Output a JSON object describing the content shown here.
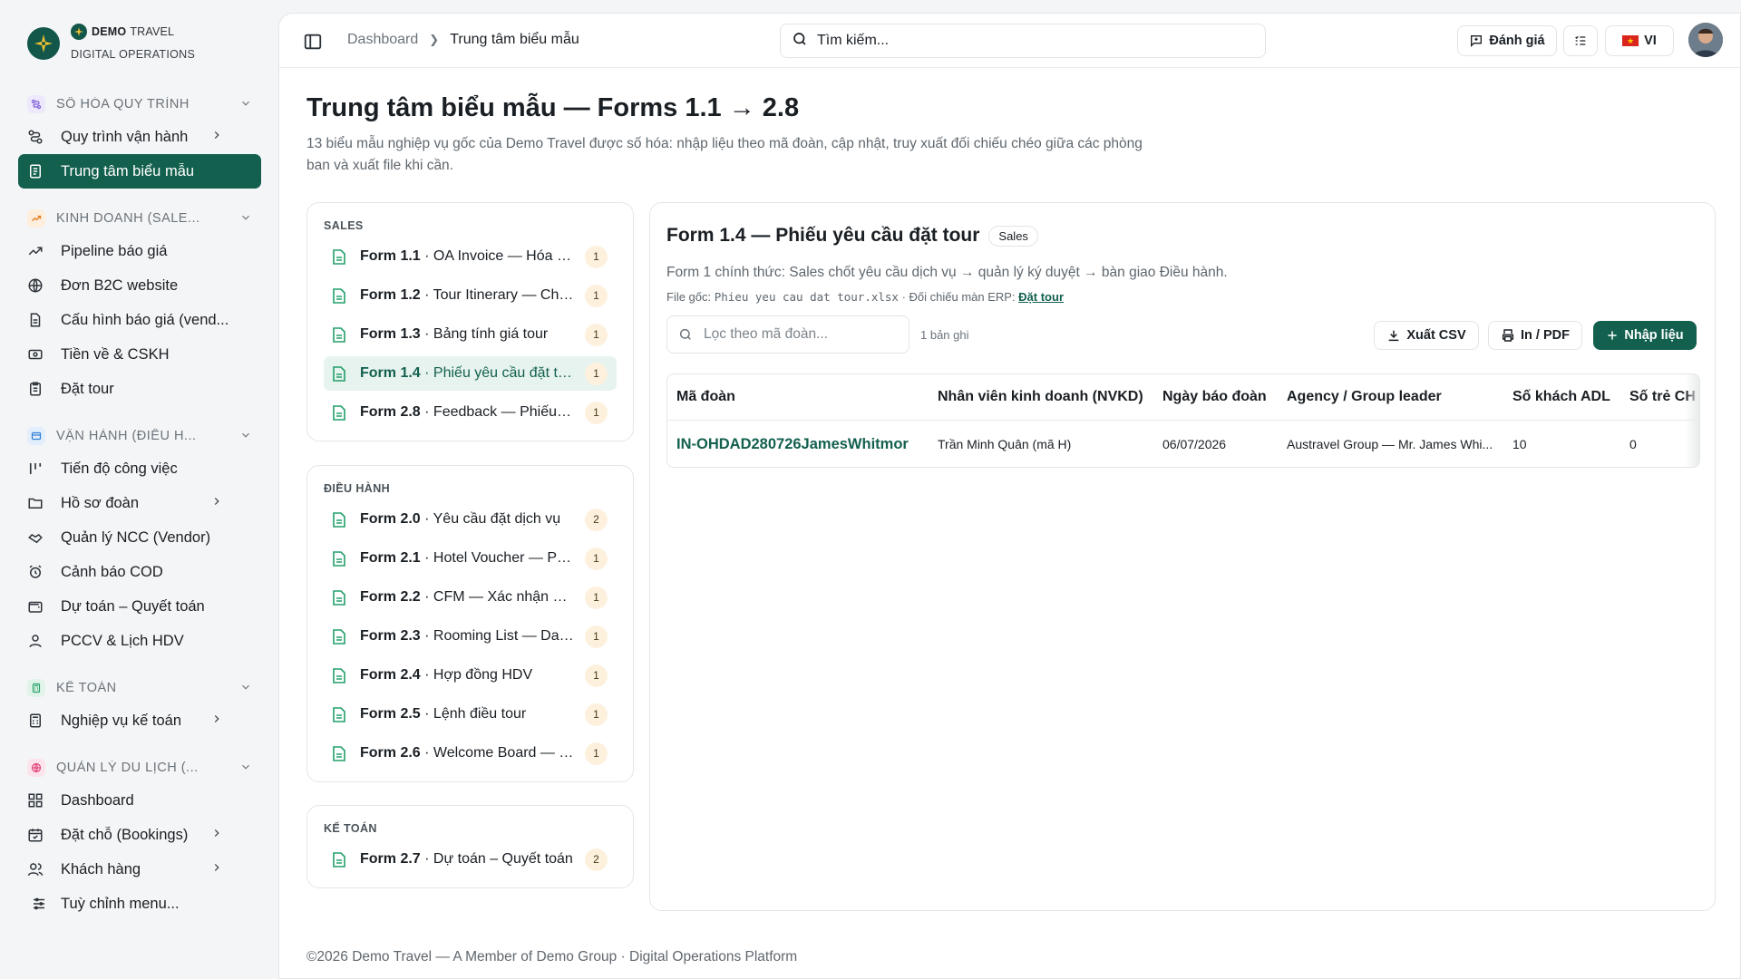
{
  "brand": {
    "name_bold": "DEMO",
    "name_light": "TRAVEL",
    "subtitle": "DIGITAL OPERATIONS"
  },
  "sidebar": {
    "sections": [
      {
        "label": "SỐ HÓA QUY TRÌNH",
        "icon": "workflow-icon",
        "color": "#7b5cd6",
        "items": [
          {
            "label": "Quy trình vận hành",
            "icon": "workflow-icon",
            "has_children": true
          },
          {
            "label": "Trung tâm biểu mẫu",
            "icon": "form-icon",
            "active": true
          }
        ]
      },
      {
        "label": "KINH DOANH (SALE...",
        "icon": "trend-icon",
        "color": "#e07b1f",
        "items": [
          {
            "label": "Pipeline báo giá",
            "icon": "trend-icon"
          },
          {
            "label": "Đơn B2C website",
            "icon": "globe-icon"
          },
          {
            "label": "Cấu hình báo giá (vend...",
            "icon": "document-icon"
          },
          {
            "label": "Tiền về & CSKH",
            "icon": "money-icon"
          },
          {
            "label": "Đặt tour",
            "icon": "clipboard-icon"
          }
        ]
      },
      {
        "label": "VẬN HÀNH (ĐIỀU H...",
        "icon": "operations-icon",
        "color": "#2f7fd3",
        "items": [
          {
            "label": "Tiến độ công việc",
            "icon": "progress-icon"
          },
          {
            "label": "Hồ sơ đoàn",
            "icon": "folder-icon",
            "has_children": true
          },
          {
            "label": "Quản lý NCC (Vendor)",
            "icon": "handshake-icon"
          },
          {
            "label": "Cảnh báo COD",
            "icon": "alarm-icon"
          },
          {
            "label": "Dự toán – Quyết toán",
            "icon": "wallet-icon"
          },
          {
            "label": "PCCV & Lịch HDV",
            "icon": "user-icon"
          }
        ]
      },
      {
        "label": "KẾ TOÁN",
        "icon": "calculator-icon",
        "color": "#22a06b",
        "items": [
          {
            "label": "Nghiệp vụ kế toán",
            "icon": "calculator-icon",
            "has_children": true
          }
        ]
      },
      {
        "label": "QUẢN LÝ DU LỊCH (...",
        "icon": "globe-icon",
        "color": "#e0457b",
        "items": [
          {
            "label": "Dashboard",
            "icon": "grid-icon"
          },
          {
            "label": "Đặt chỗ (Bookings)",
            "icon": "calendar-icon",
            "has_children": true
          },
          {
            "label": "Khách hàng",
            "icon": "users-icon",
            "has_children": true
          }
        ]
      }
    ],
    "customize_label": "Tuỳ chỉnh menu..."
  },
  "topbar": {
    "breadcrumb": [
      "Dashboard",
      "Trung tâm biểu mẫu"
    ],
    "search_placeholder": "Tìm kiếm...",
    "feedback_label": "Đánh giá",
    "language_label": "VI"
  },
  "page": {
    "title": "Trung tâm biểu mẫu — Forms 1.1 → 2.8",
    "description": "13 biểu mẫu nghiệp vụ gốc của Demo Travel được số hóa: nhập liệu theo mã đoàn, cập nhật, truy xuất đối chiếu chéo giữa các phòng ban và xuất file khi cần."
  },
  "categories": [
    {
      "title": "SALES",
      "forms": [
        {
          "code": "Form 1.1",
          "name": "· OA Invoice — Hóa đơn",
          "count": "1"
        },
        {
          "code": "Form 1.2",
          "name": "· Tour Itinerary — Chương trình",
          "count": "1"
        },
        {
          "code": "Form 1.3",
          "name": "· Bảng tính giá tour",
          "count": "1"
        },
        {
          "code": "Form 1.4",
          "name": "· Phiếu yêu cầu đặt tour",
          "count": "1",
          "selected": true
        },
        {
          "code": "Form 2.8",
          "name": "· Feedback — Phiếu góp ý",
          "count": "1"
        }
      ]
    },
    {
      "title": "ĐIỀU HÀNH",
      "forms": [
        {
          "code": "Form 2.0",
          "name": "· Yêu cầu đặt dịch vụ",
          "count": "2"
        },
        {
          "code": "Form 2.1",
          "name": "· Hotel Voucher — Phiếu",
          "count": "1"
        },
        {
          "code": "Form 2.2",
          "name": "· CFM — Xác nhận dịch vụ",
          "count": "1"
        },
        {
          "code": "Form 2.3",
          "name": "· Rooming List — Danh sách",
          "count": "1"
        },
        {
          "code": "Form 2.4",
          "name": "· Hợp đồng HDV",
          "count": "1"
        },
        {
          "code": "Form 2.5",
          "name": "· Lệnh điều tour",
          "count": "1"
        },
        {
          "code": "Form 2.6",
          "name": "· Welcome Board — Bảng đón",
          "count": "1"
        }
      ]
    },
    {
      "title": "KẾ TOÁN",
      "forms": [
        {
          "code": "Form 2.7",
          "name": "· Dự toán – Quyết toán",
          "count": "2"
        }
      ]
    }
  ],
  "detail": {
    "title": "Form 1.4 — Phiếu yêu cầu đặt tour",
    "tag": "Sales",
    "description": "Form 1 chính thức: Sales chốt yêu cầu dịch vụ → quản lý ký duyệt → bàn giao Điều hành.",
    "file_prefix": "File gốc: ",
    "file_name": "Phieu yeu cau dat tour.xlsx",
    "erp_prefix": " · Đối chiếu màn ERP: ",
    "erp_link": "Đặt tour",
    "filter_placeholder": "Lọc theo mã đoàn...",
    "record_count": "1 bản ghi",
    "export_csv": "Xuất CSV",
    "print_pdf": "In / PDF",
    "add_entry": "Nhập liệu",
    "columns": [
      "Mã đoàn",
      "Nhân viên kinh doanh (NVKD)",
      "Ngày báo đoàn",
      "Agency / Group leader",
      "Số khách ADL",
      "Số trẻ CH"
    ],
    "rows": [
      [
        "IN-OHDAD280726JamesWhitmor",
        "Trần Minh Quân (mã H)",
        "06/07/2026",
        "Austravel Group — Mr. James Whi...",
        "10",
        "0"
      ]
    ]
  },
  "footer": "©2026 Demo Travel — A Member of Demo Group · Digital Operations Platform",
  "colors": {
    "primary": "#13604f",
    "accent_green": "#22a06b",
    "badge_bg": "#fdf1de"
  }
}
